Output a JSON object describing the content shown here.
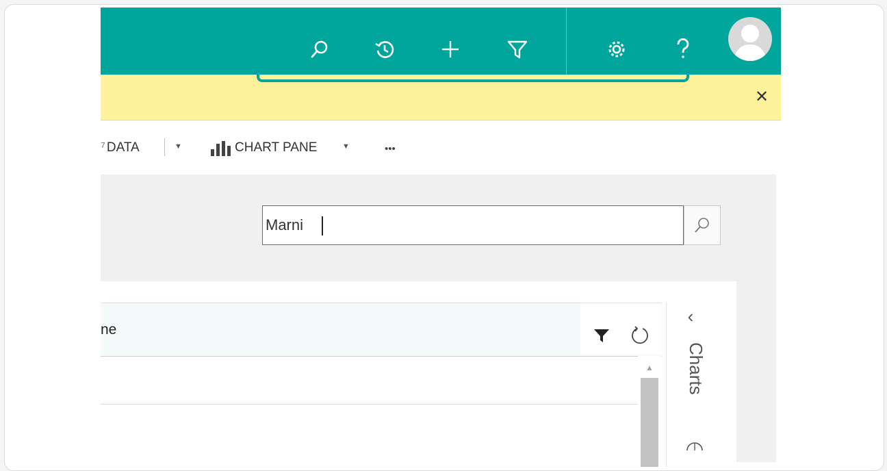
{
  "topbar": {
    "icons": [
      "search-icon",
      "history-icon",
      "plus-icon",
      "filter-icon",
      "gear-icon",
      "help-icon"
    ],
    "brand_color": "#00a69c"
  },
  "notice": {
    "close_label": "✕",
    "color": "#fff29d"
  },
  "command_bar": {
    "data_label": "DATA",
    "chart_pane_label": "CHART PANE",
    "more_label": "•••"
  },
  "search": {
    "value": "Marni"
  },
  "grid": {
    "column_label": "ne"
  },
  "charts_panel": {
    "label": "Charts"
  }
}
